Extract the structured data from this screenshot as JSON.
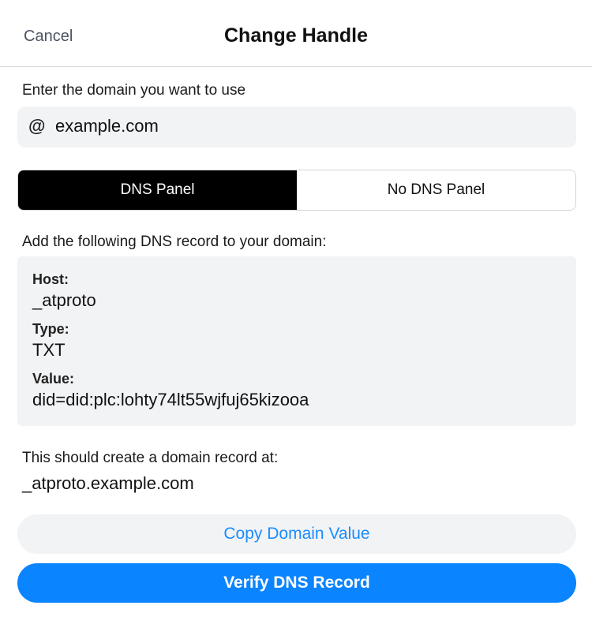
{
  "header": {
    "cancel_label": "Cancel",
    "title": "Change Handle"
  },
  "domain": {
    "label": "Enter the domain you want to use",
    "prefix_icon": "at-sign-icon",
    "value": "example.com"
  },
  "segment": {
    "options": [
      "DNS Panel",
      "No DNS Panel"
    ],
    "selected": "DNS Panel"
  },
  "instructions": "Add the following DNS record to your domain:",
  "record": {
    "host_label": "Host:",
    "host_value": "_atproto",
    "type_label": "Type:",
    "type_value": "TXT",
    "value_label": "Value:",
    "value_value": "did=did:plc:lohty74lt55wjfuj65kizooa"
  },
  "result": {
    "label": "This should create a domain record at:",
    "fqdn": "_atproto.example.com"
  },
  "buttons": {
    "copy_label": "Copy Domain Value",
    "verify_label": "Verify DNS Record"
  },
  "colors": {
    "accent": "#0a84ff",
    "link": "#1a8cff",
    "segment_active_bg": "#000000",
    "field_bg": "#f2f3f5"
  }
}
